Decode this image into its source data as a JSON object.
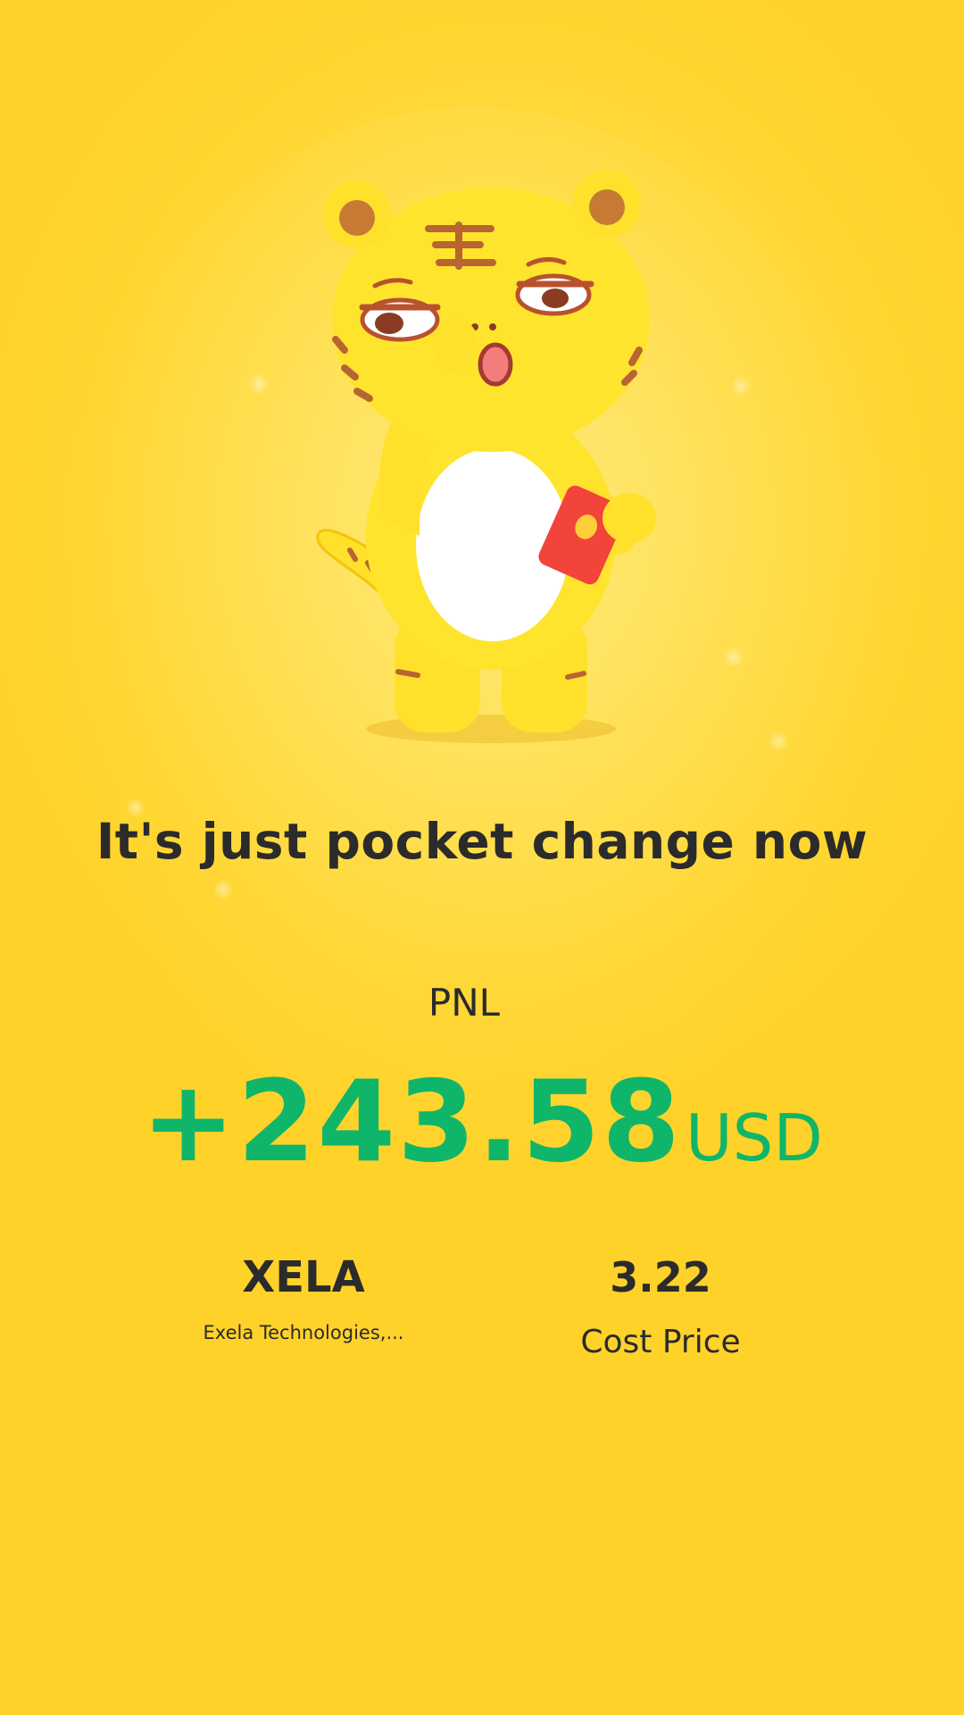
{
  "headline": "It's just pocket change now",
  "pnl": {
    "label": "PNL",
    "value": "+243.58",
    "unit": "USD"
  },
  "stock": {
    "ticker": "XELA",
    "company": "Exela Technologies,..."
  },
  "cost": {
    "value": "3.22",
    "label": "Cost Price"
  },
  "mascot": {
    "icon": "tiger-mascot-icon",
    "holds": "red-envelope-icon"
  },
  "colors": {
    "background": "#ffd52f",
    "profit_green": "#0fb66a",
    "text_dark": "#2b2b2b",
    "envelope_red": "#f2443a"
  }
}
